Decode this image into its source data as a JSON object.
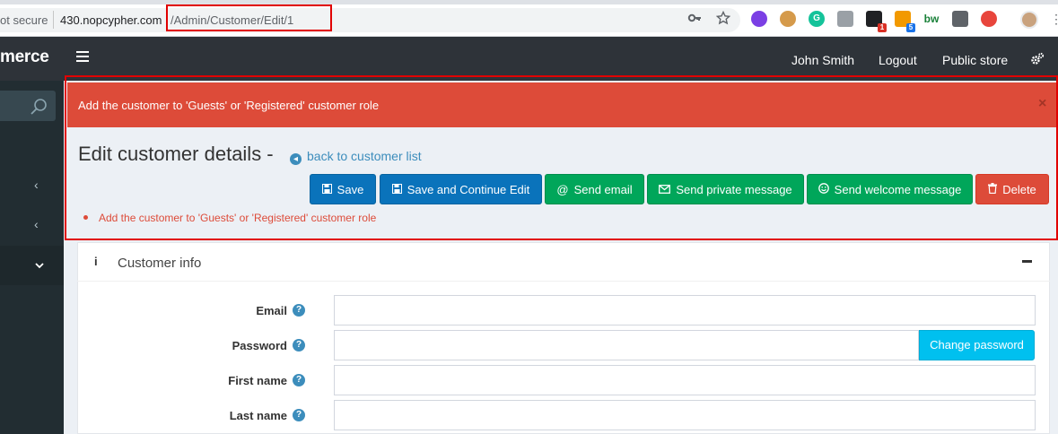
{
  "browser": {
    "security_text": "ot secure",
    "url_host": "430.nopcypher.com",
    "url_path": "/Admin/Customer/Edit/1",
    "extensions": [
      {
        "name": "color-picker-extension",
        "color": "#7b3fe4"
      },
      {
        "name": "cookie-extension",
        "color": "#d59a4b"
      },
      {
        "name": "grammarly-extension",
        "color": "#15c39a"
      },
      {
        "name": "reader-extension",
        "color": "#9aa0a6"
      },
      {
        "name": "notion-extension",
        "color": "#202124",
        "badge": "1",
        "badge_color": "#d93025"
      },
      {
        "name": "rss-extension",
        "color": "#f29900",
        "badge": "5",
        "badge_color": "#1a73e8"
      },
      {
        "name": "bw-extension",
        "color": "#188038"
      },
      {
        "name": "bulb-extension",
        "color": "#5f6368"
      },
      {
        "name": "lastpass-extension",
        "color": "#e8453c"
      }
    ],
    "ext_texts": {
      "bw": "bw"
    }
  },
  "header": {
    "logo_text": "merce",
    "user_name": "John Smith",
    "logout": "Logout",
    "public_store": "Public store"
  },
  "alert": {
    "message": "Add the customer to 'Guests' or 'Registered' customer role",
    "close": "×"
  },
  "page": {
    "title": "Edit customer details -",
    "back_link": "back to customer list"
  },
  "toolbar": {
    "save": "Save",
    "save_continue": "Save and Continue Edit",
    "send_email": "Send email",
    "send_private": "Send private message",
    "send_welcome": "Send welcome message",
    "delete": "Delete"
  },
  "validation": {
    "error": "Add the customer to 'Guests' or 'Registered' customer role"
  },
  "panel": {
    "info_symbol": "i",
    "title": "Customer info"
  },
  "form": {
    "email_label": "Email",
    "password_label": "Password",
    "first_name_label": "First name",
    "last_name_label": "Last name",
    "change_password": "Change password"
  },
  "colors": {
    "alert_red": "#dd4b39",
    "primary_blue": "#0a73bb",
    "success_green": "#00a65a",
    "info_cyan": "#00c0ef",
    "header_dark": "#2e3339",
    "sidebar_dark": "#222d32"
  }
}
